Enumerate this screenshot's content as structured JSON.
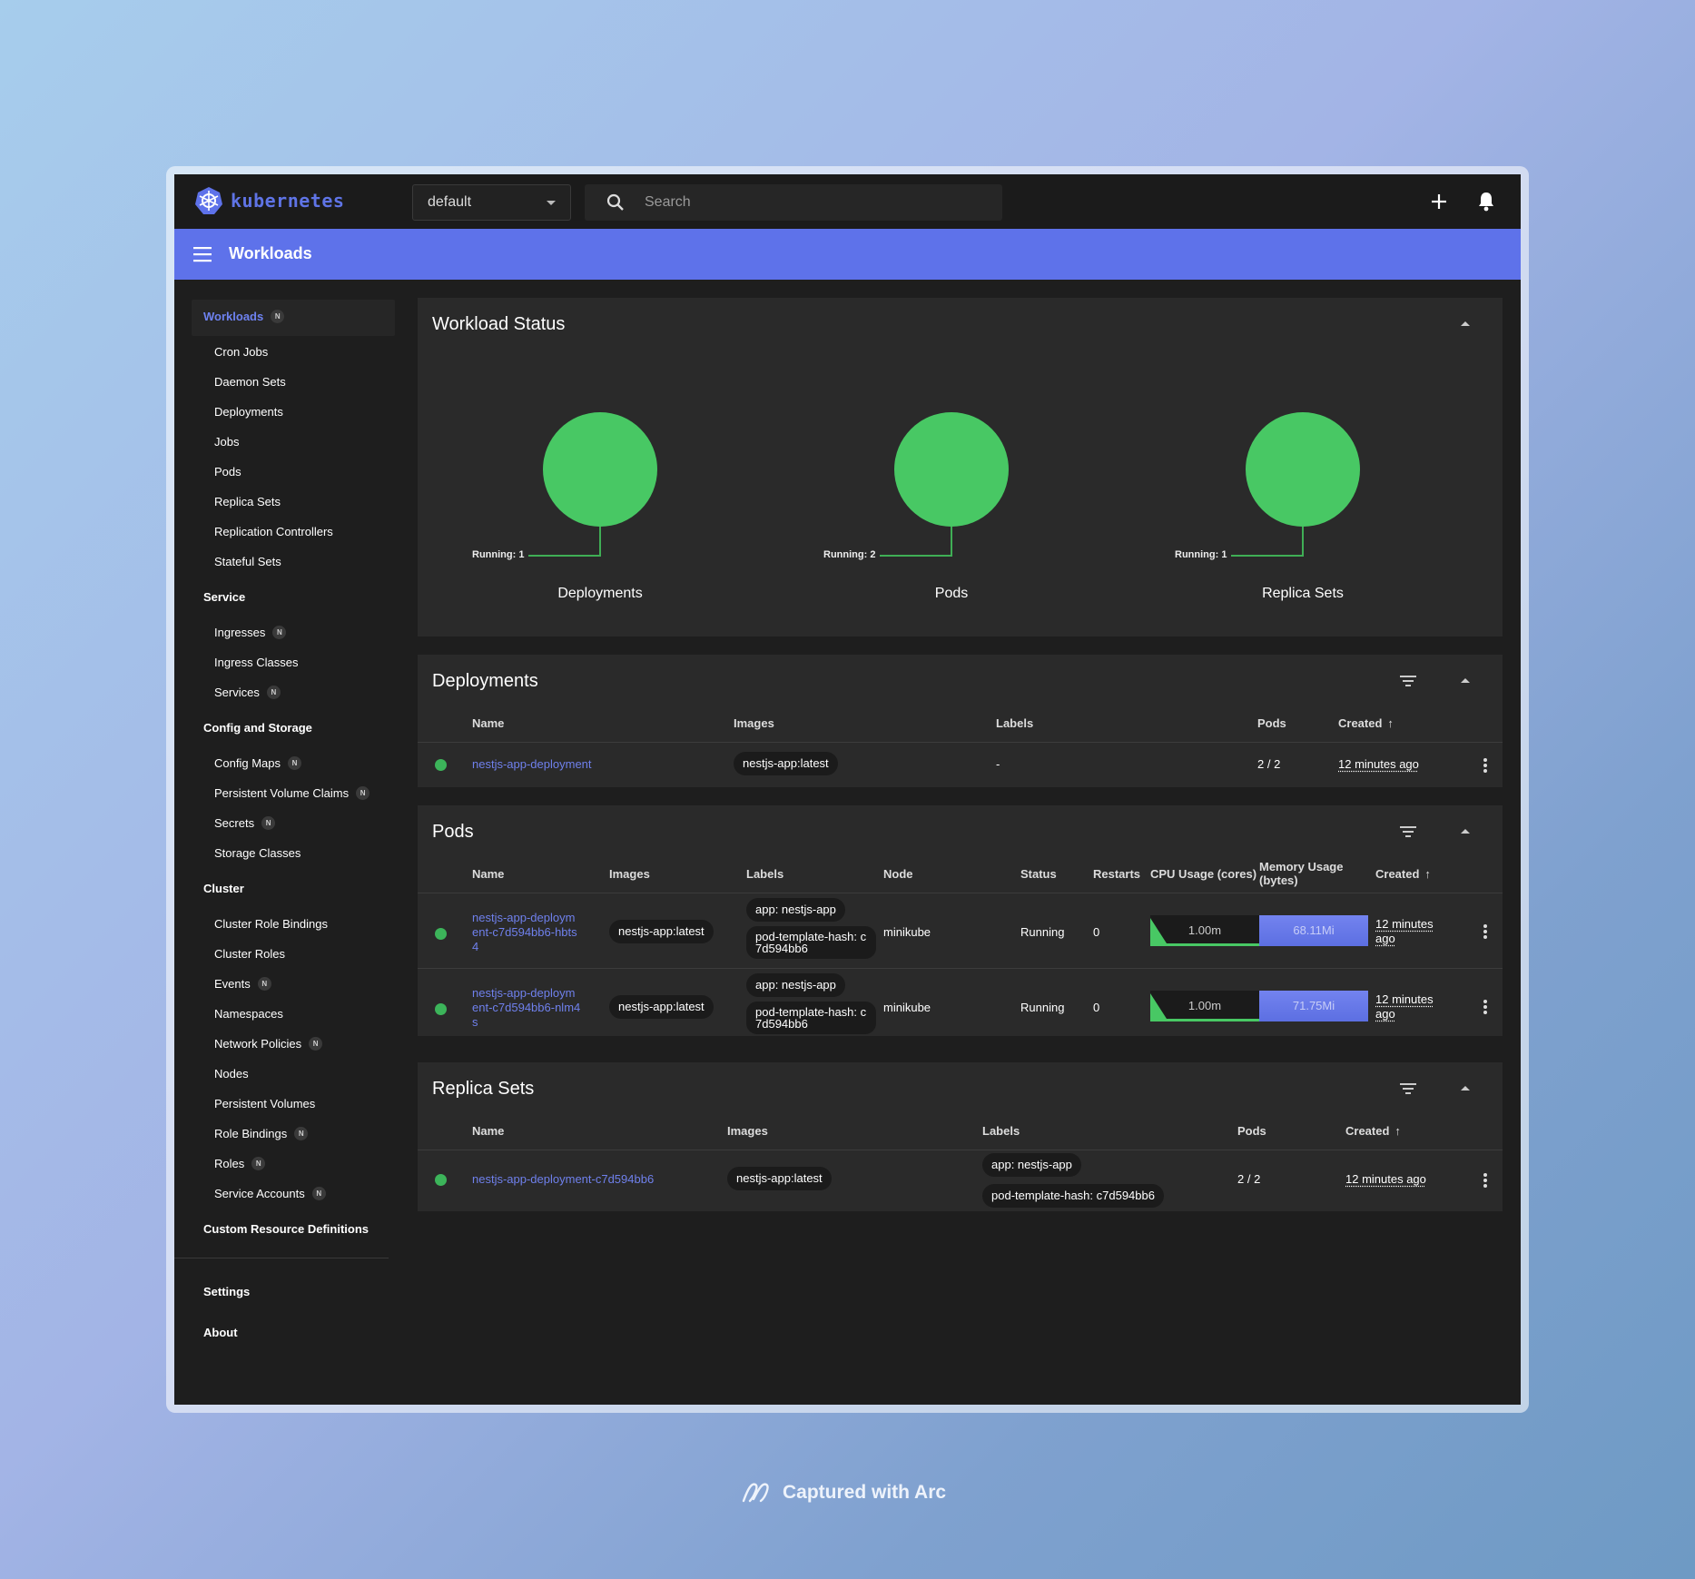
{
  "topbar": {
    "brand": "kubernetes",
    "namespace": "default",
    "search_placeholder": "Search"
  },
  "appbar": {
    "title": "Workloads"
  },
  "sidebar": {
    "workloads": {
      "label": "Workloads",
      "badge": "N"
    },
    "workload_items": [
      "Cron Jobs",
      "Daemon Sets",
      "Deployments",
      "Jobs",
      "Pods",
      "Replica Sets",
      "Replication Controllers",
      "Stateful Sets"
    ],
    "service": {
      "label": "Service"
    },
    "service_items": [
      {
        "label": "Ingresses",
        "badge": "N"
      },
      {
        "label": "Ingress Classes"
      },
      {
        "label": "Services",
        "badge": "N"
      }
    ],
    "config": {
      "label": "Config and Storage"
    },
    "config_items": [
      {
        "label": "Config Maps",
        "badge": "N"
      },
      {
        "label": "Persistent Volume Claims",
        "badge": "N"
      },
      {
        "label": "Secrets",
        "badge": "N"
      },
      {
        "label": "Storage Classes"
      }
    ],
    "cluster": {
      "label": "Cluster"
    },
    "cluster_items": [
      {
        "label": "Cluster Role Bindings"
      },
      {
        "label": "Cluster Roles"
      },
      {
        "label": "Events",
        "badge": "N"
      },
      {
        "label": "Namespaces"
      },
      {
        "label": "Network Policies",
        "badge": "N"
      },
      {
        "label": "Nodes"
      },
      {
        "label": "Persistent Volumes"
      },
      {
        "label": "Role Bindings",
        "badge": "N"
      },
      {
        "label": "Roles",
        "badge": "N"
      },
      {
        "label": "Service Accounts",
        "badge": "N"
      }
    ],
    "crd": {
      "label": "Custom Resource Definitions"
    },
    "settings": {
      "label": "Settings"
    },
    "about": {
      "label": "About"
    }
  },
  "workload_status": {
    "title": "Workload Status",
    "items": [
      {
        "name": "Deployments",
        "label": "Running: 1"
      },
      {
        "name": "Pods",
        "label": "Running: 2"
      },
      {
        "name": "Replica Sets",
        "label": "Running: 1"
      }
    ]
  },
  "deployments": {
    "title": "Deployments",
    "headers": {
      "name": "Name",
      "images": "Images",
      "labels": "Labels",
      "pods": "Pods",
      "created": "Created"
    },
    "rows": [
      {
        "name": "nestjs-app-deployment",
        "image": "nestjs-app:latest",
        "labels": "-",
        "pods": "2 / 2",
        "created": "12 minutes ago"
      }
    ]
  },
  "pods": {
    "title": "Pods",
    "headers": {
      "name": "Name",
      "images": "Images",
      "labels": "Labels",
      "node": "Node",
      "status": "Status",
      "restarts": "Restarts",
      "cpu": "CPU Usage (cores)",
      "memory": "Memory Usage (bytes)",
      "created": "Created"
    },
    "rows": [
      {
        "name": "nestjs-app-deployment-c7d594bb6-hbts4",
        "image": "nestjs-app:latest",
        "label1": "app: nestjs-app",
        "label2": "pod-template-hash: c7d594bb6",
        "node": "minikube",
        "status": "Running",
        "restarts": "0",
        "cpu": "1.00m",
        "memory": "68.11Mi",
        "created": "12 minutes ago"
      },
      {
        "name": "nestjs-app-deployment-c7d594bb6-nlm4s",
        "image": "nestjs-app:latest",
        "label1": "app: nestjs-app",
        "label2": "pod-template-hash: c7d594bb6",
        "node": "minikube",
        "status": "Running",
        "restarts": "0",
        "cpu": "1.00m",
        "memory": "71.75Mi",
        "created": "12 minutes ago"
      }
    ]
  },
  "replicasets": {
    "title": "Replica Sets",
    "headers": {
      "name": "Name",
      "images": "Images",
      "labels": "Labels",
      "pods": "Pods",
      "created": "Created"
    },
    "rows": [
      {
        "name": "nestjs-app-deployment-c7d594bb6",
        "image": "nestjs-app:latest",
        "label1": "app: nestjs-app",
        "label2": "pod-template-hash: c7d594bb6",
        "pods": "2 / 2",
        "created": "12 minutes ago"
      }
    ]
  },
  "footer": {
    "text": "Captured with Arc"
  },
  "colors": {
    "accent": "#5e72ea",
    "running": "#48c864",
    "link": "#6f80ec"
  }
}
